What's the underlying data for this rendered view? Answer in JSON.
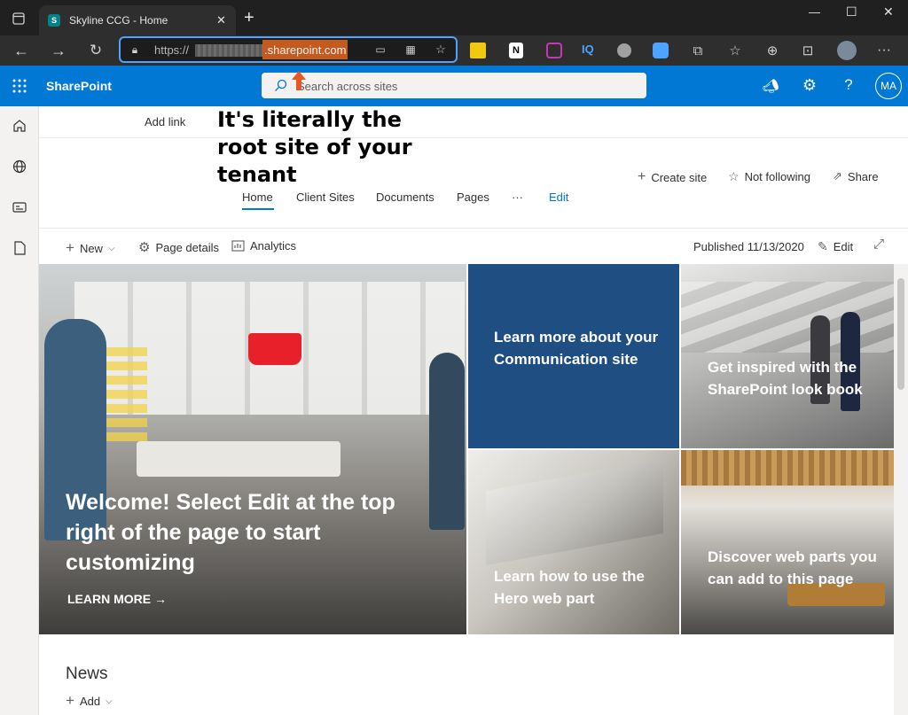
{
  "browser": {
    "tab_title": "Skyline CCG - Home",
    "new_tab": "+",
    "url_prefix": "https://",
    "url_domain": ".sharepoint.com",
    "window_controls": {
      "minimize": "—",
      "maximize": "☐",
      "close": "✕"
    }
  },
  "header": {
    "app_name": "SharePoint",
    "search_placeholder": "Search across sites",
    "avatar": "MA"
  },
  "site": {
    "add_link": "Add link",
    "annotation": "It's literally the root site of your tenant",
    "actions": {
      "create": "Create site",
      "follow": "Not following",
      "share": "Share"
    },
    "nav": [
      "Home",
      "Client Sites",
      "Documents",
      "Pages",
      "···",
      "Edit"
    ]
  },
  "command_bar": {
    "new": "New",
    "page_details": "Page details",
    "analytics": "Analytics",
    "published": "Published 11/13/2020",
    "edit": "Edit"
  },
  "hero": {
    "main_title": "Welcome! Select Edit at the top right of the page to start customizing",
    "main_link": "LEARN MORE →",
    "tile_1": "Learn more about your Communication site",
    "tile_2": "Get inspired with the SharePoint look book",
    "tile_3": "Learn how to use the Hero web part",
    "tile_4": "Discover web parts you can add to this page"
  },
  "news": {
    "title": "News",
    "add": "Add"
  },
  "colors": {
    "accent": "#0078d4",
    "tile_blue": "#1f4e82",
    "annotation": "#000000",
    "arrow": "#e8562a"
  }
}
